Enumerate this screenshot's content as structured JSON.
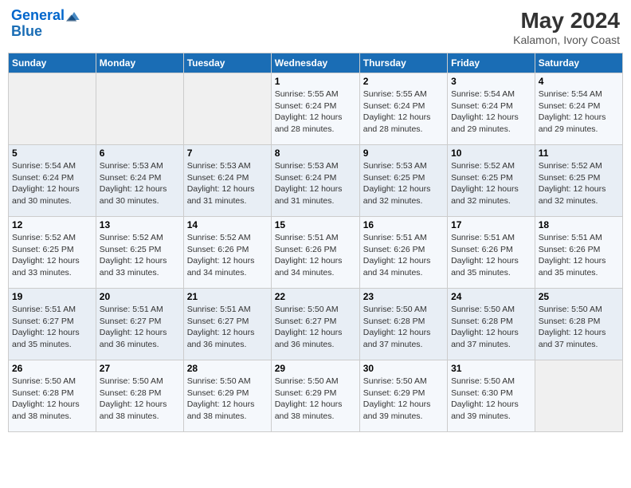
{
  "logo": {
    "line1": "General",
    "line2": "Blue"
  },
  "title": "May 2024",
  "subtitle": "Kalamon, Ivory Coast",
  "days_of_week": [
    "Sunday",
    "Monday",
    "Tuesday",
    "Wednesday",
    "Thursday",
    "Friday",
    "Saturday"
  ],
  "weeks": [
    [
      {
        "day": "",
        "info": ""
      },
      {
        "day": "",
        "info": ""
      },
      {
        "day": "",
        "info": ""
      },
      {
        "day": "1",
        "info": "Sunrise: 5:55 AM\nSunset: 6:24 PM\nDaylight: 12 hours\nand 28 minutes."
      },
      {
        "day": "2",
        "info": "Sunrise: 5:55 AM\nSunset: 6:24 PM\nDaylight: 12 hours\nand 28 minutes."
      },
      {
        "day": "3",
        "info": "Sunrise: 5:54 AM\nSunset: 6:24 PM\nDaylight: 12 hours\nand 29 minutes."
      },
      {
        "day": "4",
        "info": "Sunrise: 5:54 AM\nSunset: 6:24 PM\nDaylight: 12 hours\nand 29 minutes."
      }
    ],
    [
      {
        "day": "5",
        "info": "Sunrise: 5:54 AM\nSunset: 6:24 PM\nDaylight: 12 hours\nand 30 minutes."
      },
      {
        "day": "6",
        "info": "Sunrise: 5:53 AM\nSunset: 6:24 PM\nDaylight: 12 hours\nand 30 minutes."
      },
      {
        "day": "7",
        "info": "Sunrise: 5:53 AM\nSunset: 6:24 PM\nDaylight: 12 hours\nand 31 minutes."
      },
      {
        "day": "8",
        "info": "Sunrise: 5:53 AM\nSunset: 6:24 PM\nDaylight: 12 hours\nand 31 minutes."
      },
      {
        "day": "9",
        "info": "Sunrise: 5:53 AM\nSunset: 6:25 PM\nDaylight: 12 hours\nand 32 minutes."
      },
      {
        "day": "10",
        "info": "Sunrise: 5:52 AM\nSunset: 6:25 PM\nDaylight: 12 hours\nand 32 minutes."
      },
      {
        "day": "11",
        "info": "Sunrise: 5:52 AM\nSunset: 6:25 PM\nDaylight: 12 hours\nand 32 minutes."
      }
    ],
    [
      {
        "day": "12",
        "info": "Sunrise: 5:52 AM\nSunset: 6:25 PM\nDaylight: 12 hours\nand 33 minutes."
      },
      {
        "day": "13",
        "info": "Sunrise: 5:52 AM\nSunset: 6:25 PM\nDaylight: 12 hours\nand 33 minutes."
      },
      {
        "day": "14",
        "info": "Sunrise: 5:52 AM\nSunset: 6:26 PM\nDaylight: 12 hours\nand 34 minutes."
      },
      {
        "day": "15",
        "info": "Sunrise: 5:51 AM\nSunset: 6:26 PM\nDaylight: 12 hours\nand 34 minutes."
      },
      {
        "day": "16",
        "info": "Sunrise: 5:51 AM\nSunset: 6:26 PM\nDaylight: 12 hours\nand 34 minutes."
      },
      {
        "day": "17",
        "info": "Sunrise: 5:51 AM\nSunset: 6:26 PM\nDaylight: 12 hours\nand 35 minutes."
      },
      {
        "day": "18",
        "info": "Sunrise: 5:51 AM\nSunset: 6:26 PM\nDaylight: 12 hours\nand 35 minutes."
      }
    ],
    [
      {
        "day": "19",
        "info": "Sunrise: 5:51 AM\nSunset: 6:27 PM\nDaylight: 12 hours\nand 35 minutes."
      },
      {
        "day": "20",
        "info": "Sunrise: 5:51 AM\nSunset: 6:27 PM\nDaylight: 12 hours\nand 36 minutes."
      },
      {
        "day": "21",
        "info": "Sunrise: 5:51 AM\nSunset: 6:27 PM\nDaylight: 12 hours\nand 36 minutes."
      },
      {
        "day": "22",
        "info": "Sunrise: 5:50 AM\nSunset: 6:27 PM\nDaylight: 12 hours\nand 36 minutes."
      },
      {
        "day": "23",
        "info": "Sunrise: 5:50 AM\nSunset: 6:28 PM\nDaylight: 12 hours\nand 37 minutes."
      },
      {
        "day": "24",
        "info": "Sunrise: 5:50 AM\nSunset: 6:28 PM\nDaylight: 12 hours\nand 37 minutes."
      },
      {
        "day": "25",
        "info": "Sunrise: 5:50 AM\nSunset: 6:28 PM\nDaylight: 12 hours\nand 37 minutes."
      }
    ],
    [
      {
        "day": "26",
        "info": "Sunrise: 5:50 AM\nSunset: 6:28 PM\nDaylight: 12 hours\nand 38 minutes."
      },
      {
        "day": "27",
        "info": "Sunrise: 5:50 AM\nSunset: 6:28 PM\nDaylight: 12 hours\nand 38 minutes."
      },
      {
        "day": "28",
        "info": "Sunrise: 5:50 AM\nSunset: 6:29 PM\nDaylight: 12 hours\nand 38 minutes."
      },
      {
        "day": "29",
        "info": "Sunrise: 5:50 AM\nSunset: 6:29 PM\nDaylight: 12 hours\nand 38 minutes."
      },
      {
        "day": "30",
        "info": "Sunrise: 5:50 AM\nSunset: 6:29 PM\nDaylight: 12 hours\nand 39 minutes."
      },
      {
        "day": "31",
        "info": "Sunrise: 5:50 AM\nSunset: 6:30 PM\nDaylight: 12 hours\nand 39 minutes."
      },
      {
        "day": "",
        "info": ""
      }
    ]
  ]
}
